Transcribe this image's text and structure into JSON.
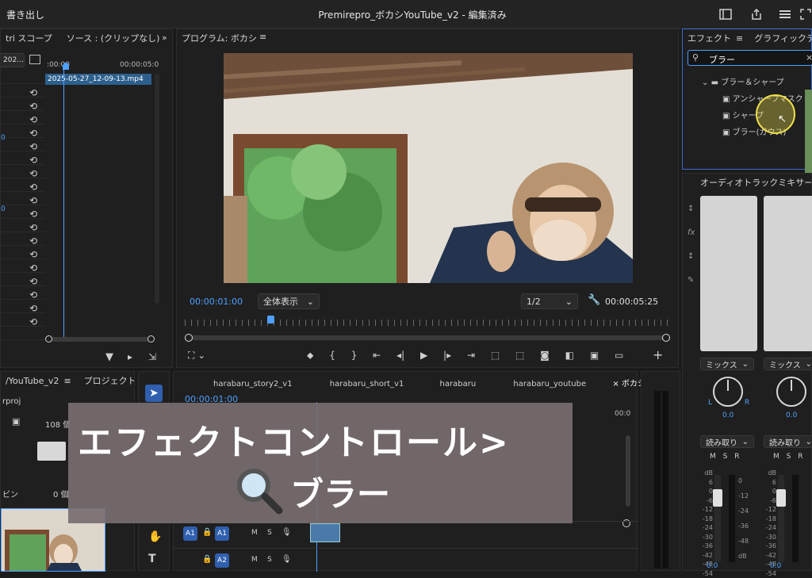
{
  "titlebar": {
    "left_label": "書き出し",
    "title": "Premirepro_ボカシYouTube_v2 - 編集済み"
  },
  "source_panel": {
    "tab_scope": "tri スコープ",
    "tab_source": "ソース : (クリップなし)",
    "timecode_start": ":00:00",
    "timecode_end": "00:00:05:0",
    "clip_name": "2025-05-27_12-09-13.mp4",
    "dropdown": "202..."
  },
  "program_monitor": {
    "tab": "プログラム: ボカシ",
    "current_time": "00:00:01:00",
    "zoom": "全体表示",
    "resolution": "1/2",
    "duration": "00:00:05:25",
    "playhead_fraction": 0.17
  },
  "effects_panel": {
    "tab_effects": "エフェクト",
    "tab_graphics": "グラフィックテ",
    "search_value": "ブラー",
    "folder": "ブラー＆シャープ",
    "items": [
      "アンシャープマスク",
      "シャープ",
      "ブラー(ガウス)"
    ]
  },
  "audio_mixer": {
    "tab": "オーディオトラックミキサー",
    "channels": [
      {
        "mix": "ミックス",
        "pan": "0.0",
        "mode": "読み取り",
        "value": "0.0"
      },
      {
        "mix": "ミックス",
        "pan": "0.0",
        "mode": "読み取り",
        "value": "0.0"
      }
    ],
    "labels": {
      "L": "L",
      "R": "R",
      "M": "M",
      "S": "S",
      "Rbtn": "R",
      "db": "dB"
    },
    "scale": [
      "0",
      "-12",
      "-24",
      "-36",
      "-48",
      "dB"
    ],
    "meter_left": [
      "6",
      "0",
      "-6",
      "-12",
      "-18",
      "-24",
      "-30",
      "-36",
      "-42",
      "-48",
      "-54"
    ]
  },
  "project_panel": {
    "tab_seq": "/YouTube_v2",
    "tab_project": "プロジェクト",
    "file": "rproj",
    "count": "108 個",
    "bin_label": "ビン",
    "bin_count": "0 個"
  },
  "timeline": {
    "tabs": [
      "harabaru_story2_v1",
      "harabaru_short_v1",
      "harabaru",
      "harabaru_youtube",
      "ボカシ"
    ],
    "timecode": "00:00:01:00",
    "ruler_end": "00:0",
    "tracks": [
      {
        "id": "A1",
        "label": "A1",
        "m": "M",
        "s": "S"
      },
      {
        "id": "A2",
        "label": "A2",
        "m": "M",
        "s": "S"
      }
    ]
  },
  "overlay_caption": {
    "line1": "エフェクトコントロール>",
    "line2": "ブラー"
  },
  "colors": {
    "accent": "#4ea0ff",
    "track_blue": "#2f5fae",
    "highlight": "#f0e04a"
  }
}
